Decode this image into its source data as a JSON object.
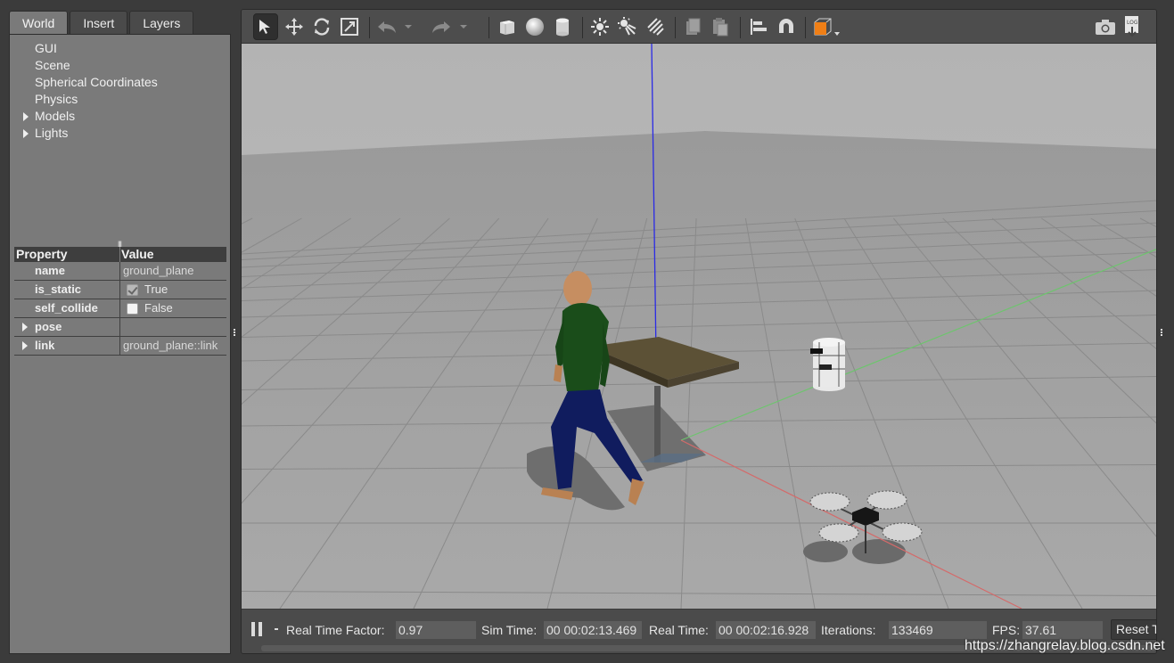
{
  "left_panel": {
    "tabs": [
      {
        "label": "World",
        "active": true
      },
      {
        "label": "Insert",
        "active": false
      },
      {
        "label": "Layers",
        "active": false
      }
    ],
    "tree": [
      {
        "label": "GUI",
        "expandable": false
      },
      {
        "label": "Scene",
        "expandable": false
      },
      {
        "label": "Spherical Coordinates",
        "expandable": false
      },
      {
        "label": "Physics",
        "expandable": false
      },
      {
        "label": "Models",
        "expandable": true
      },
      {
        "label": "Lights",
        "expandable": true
      }
    ],
    "properties": {
      "header_property": "Property",
      "header_value": "Value",
      "rows": [
        {
          "name": "name",
          "value": "ground_plane"
        },
        {
          "name": "is_static",
          "value": "True",
          "checked": true
        },
        {
          "name": "self_collide",
          "value": "False",
          "checked": false
        },
        {
          "name": "pose",
          "value": ""
        },
        {
          "name": "link",
          "value": "ground_plane::link"
        }
      ]
    }
  },
  "toolbar": {
    "icons": [
      "select-arrow",
      "translate",
      "rotate",
      "scale",
      "undo",
      "undo-dropdown",
      "redo",
      "redo-dropdown",
      "box",
      "sphere",
      "cylinder",
      "point-light",
      "spot-light",
      "directional-light",
      "copy",
      "paste",
      "align",
      "snap",
      "view-angle",
      "screenshot",
      "log"
    ],
    "active_tool": "select-arrow",
    "accent_color": "#f07f16"
  },
  "status_bar": {
    "real_time_factor_label": "Real Time Factor:",
    "real_time_factor": "0.97",
    "sim_time_label": "Sim Time:",
    "sim_time": "00 00:02:13.469",
    "real_time_label": "Real Time:",
    "real_time": "00 00:02:16.928",
    "iterations_label": "Iterations:",
    "iterations": "133469",
    "fps_label": "FPS:",
    "fps": "37.61",
    "reset_label": "Reset T"
  },
  "watermark": "https://zhangrelay.blog.csdn.net"
}
